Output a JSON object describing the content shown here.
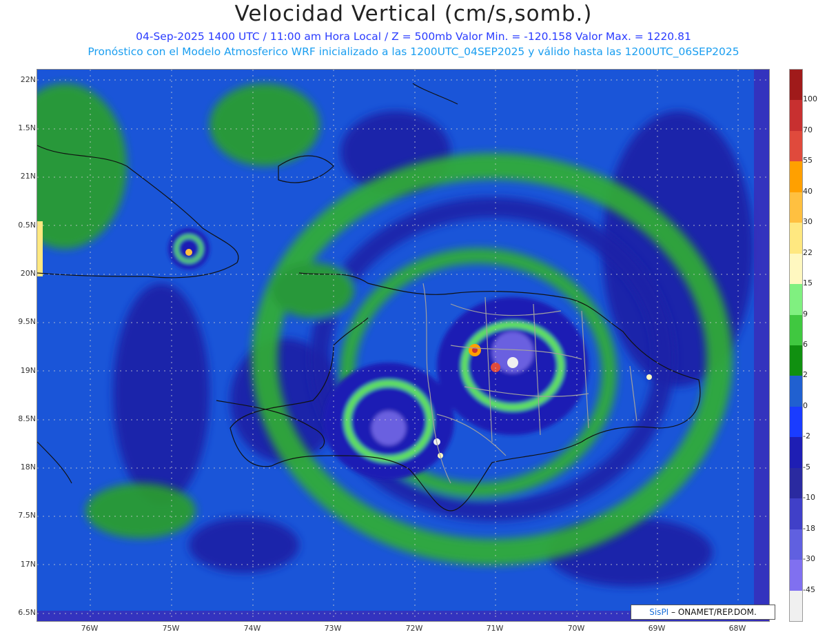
{
  "header": {
    "title": "Velocidad Vertical (cm/s,somb.)",
    "subtitle1": "04-Sep-2025 1400 UTC / 11:00 am Hora Local / Z = 500mb  Valor Min. = -120.158  Valor Max. = 1220.81",
    "subtitle2": "Pronóstico con el Modelo Atmosferico WRF inicializado a las 1200UTC_04SEP2025 y válido hasta las  1200UTC_06SEP2025"
  },
  "axes": {
    "lat_labels": [
      "22N",
      "1.5N",
      "21N",
      "0.5N",
      "20N",
      "9.5N",
      "19N",
      "8.5N",
      "18N",
      "7.5N",
      "17N",
      "6.5N"
    ],
    "lon_labels": [
      "76W",
      "75W",
      "74W",
      "73W",
      "72W",
      "71W",
      "70W",
      "69W",
      "68W"
    ]
  },
  "colorbar": {
    "labels": [
      "100",
      "70",
      "55",
      "40",
      "30",
      "22",
      "15",
      "9",
      "6",
      "2",
      "0",
      "-2",
      "-5",
      "-10",
      "-18",
      "-30",
      "-45"
    ],
    "colors": [
      "#a01a1a",
      "#c83030",
      "#e04a3c",
      "#ffa000",
      "#ffc040",
      "#ffe880",
      "#fff8c0",
      "#80f080",
      "#40c840",
      "#109010",
      "#2060d0",
      "#1a3cff",
      "#1e1eb4",
      "#2a2aa0",
      "#4040c8",
      "#6060e0",
      "#8070f0",
      "#f0f0f0"
    ]
  },
  "credit": {
    "brand": "SisPI",
    "text": "– ONAMET/REP.DOM."
  }
}
